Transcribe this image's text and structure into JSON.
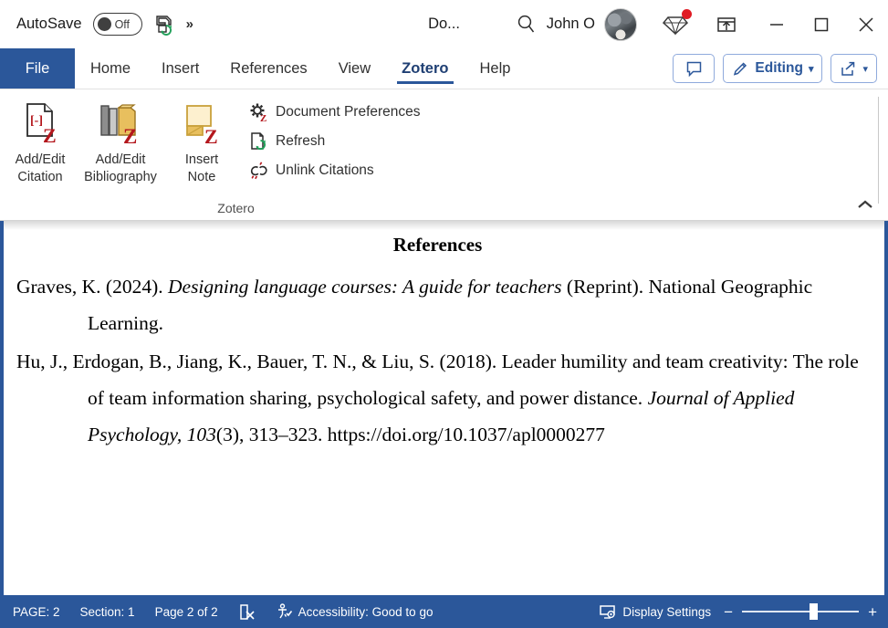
{
  "titlebar": {
    "autosave_label": "AutoSave",
    "autosave_state": "Off",
    "save_icon": "save-sync-icon",
    "more_icon": "more-commands-chevron",
    "document_title": "Do...",
    "search_icon": "search-icon",
    "account_name": "John O",
    "avatar_name": "user-avatar",
    "gem_icon": "diamond-icon",
    "share_icon": "share-up-icon",
    "minimize_icon": "minimize-icon",
    "maximize_icon": "maximize-icon",
    "close_icon": "close-icon"
  },
  "tabs": {
    "file": "File",
    "items": [
      {
        "label": "Home",
        "active": false
      },
      {
        "label": "Insert",
        "active": false
      },
      {
        "label": "References",
        "active": false
      },
      {
        "label": "View",
        "active": false
      },
      {
        "label": "Zotero",
        "active": true
      },
      {
        "label": "Help",
        "active": false
      }
    ],
    "comment_label": "",
    "editing_label": "Editing",
    "share_label": ""
  },
  "ribbon": {
    "group_label": "Zotero",
    "big_buttons": [
      {
        "line1": "Add/Edit",
        "line2": "Citation",
        "icon": "add-edit-citation-icon"
      },
      {
        "line1": "Add/Edit",
        "line2": "Bibliography",
        "icon": "add-edit-bibliography-icon"
      },
      {
        "line1": "Insert",
        "line2": "Note",
        "icon": "insert-note-icon"
      }
    ],
    "small_commands": [
      {
        "label": "Document Preferences",
        "icon": "document-preferences-icon"
      },
      {
        "label": "Refresh",
        "icon": "refresh-icon"
      },
      {
        "label": "Unlink Citations",
        "icon": "unlink-citations-icon"
      }
    ],
    "collapse_icon": "collapse-ribbon-chevron"
  },
  "document": {
    "heading": "References",
    "entries": [
      {
        "parts": [
          {
            "text": "Graves, K. (2024). ",
            "italic": false
          },
          {
            "text": "Designing language courses: A guide for teachers",
            "italic": true
          },
          {
            "text": " (Reprint). National Geographic Learning.",
            "italic": false
          }
        ]
      },
      {
        "parts": [
          {
            "text": "Hu, J., Erdogan, B., Jiang, K., Bauer, T. N., & Liu, S. (2018). Leader humility and team creativity: The role of team information sharing, psychological safety, and power distance. ",
            "italic": false
          },
          {
            "text": "Journal of Applied Psychology, 103",
            "italic": true
          },
          {
            "text": "(3), 313–323. https://doi.org/10.1037/apl0000277",
            "italic": false
          }
        ]
      }
    ]
  },
  "statusbar": {
    "page_indicator": "PAGE: 2",
    "section": "Section: 1",
    "page_of": "Page 2 of 2",
    "page_break_icon": "page-break-icon",
    "accessibility_icon": "accessibility-icon",
    "accessibility": "Accessibility: Good to go",
    "display_settings_icon": "display-settings-icon",
    "display_settings": "Display Settings",
    "zoom_out": "−",
    "zoom_in": "+",
    "zoom_position_percent": 58
  },
  "colors": {
    "office_blue": "#2b579a",
    "badge_red": "#e01b24",
    "zotero_red": "#b4171d"
  }
}
